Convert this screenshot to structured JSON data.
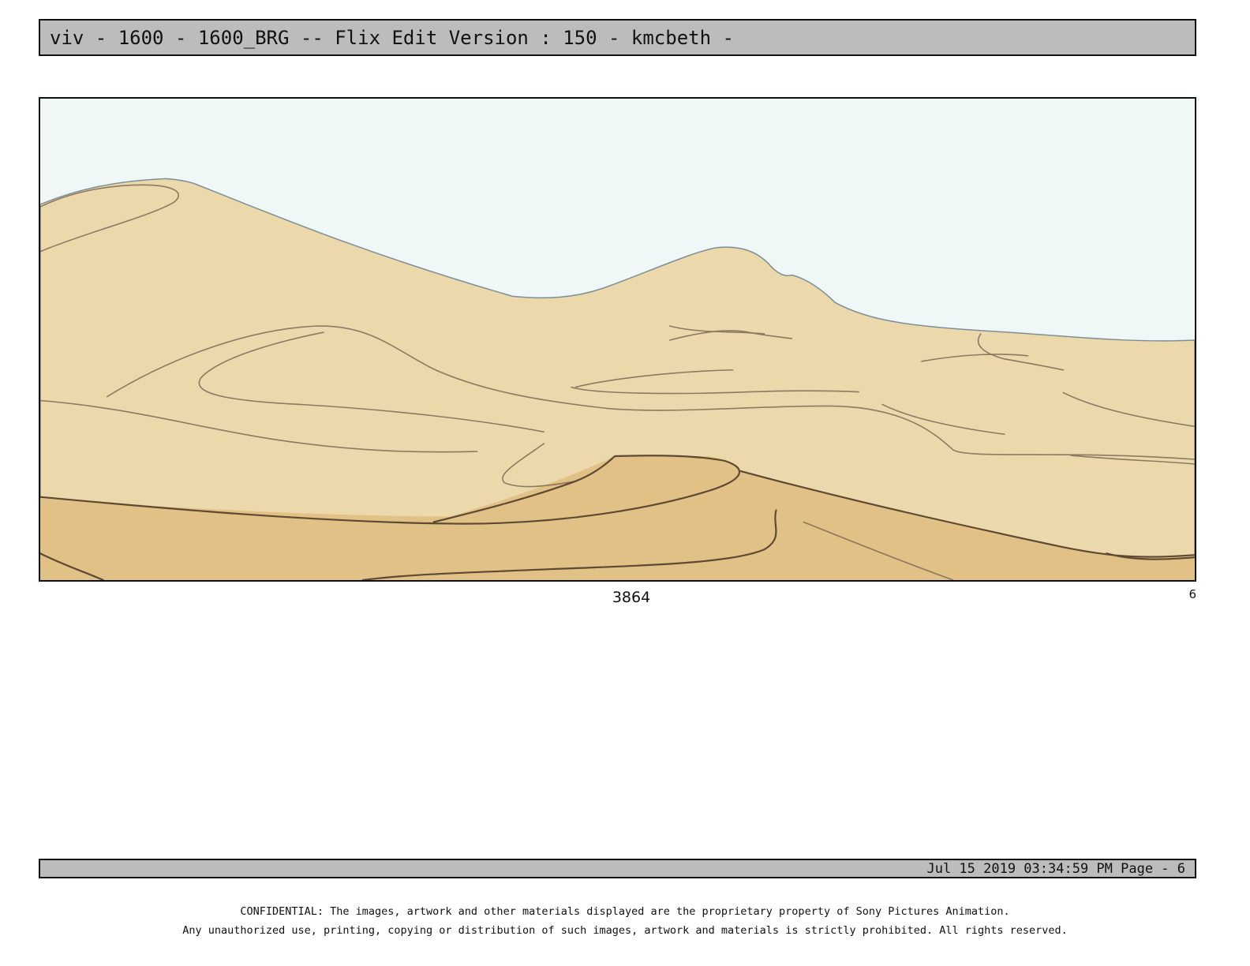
{
  "header": {
    "title": "viv - 1600 - 1600_BRG -- Flix Edit Version : 150 - kmcbeth -"
  },
  "panel": {
    "number": "3864",
    "index": "6",
    "colors": {
      "sky": "#eff7f7",
      "sand_light": "#ebd9ab",
      "sand_dark": "#e2c187",
      "line": "#6b5a45"
    }
  },
  "footer": {
    "stamp": "Jul 15 2019 03:34:59 PM Page - 6"
  },
  "confidential": {
    "line1": "CONFIDENTIAL: The images, artwork and other materials displayed are the proprietary property of Sony Pictures Animation.",
    "line2": "Any unauthorized use, printing, copying or distribution of such images, artwork and materials is strictly prohibited. All rights reserved."
  }
}
